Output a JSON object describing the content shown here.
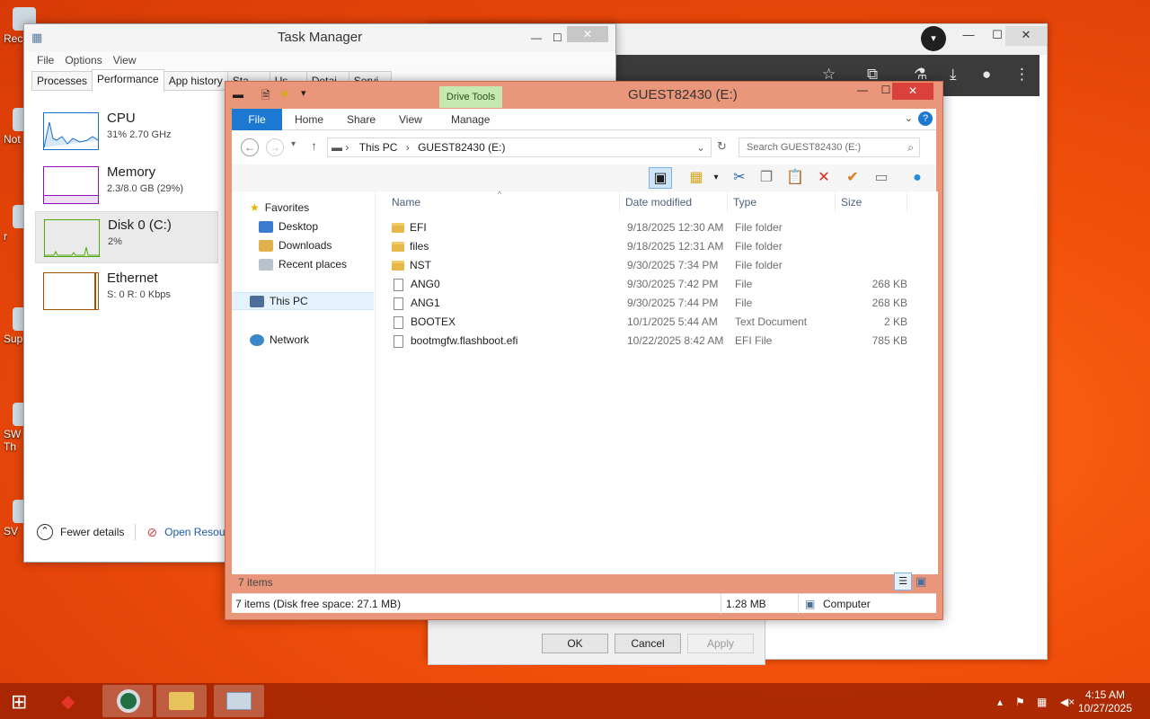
{
  "desktop": {
    "icons": [
      {
        "label": "Rec",
        "icon": "recycle-bin-icon"
      },
      {
        "label": "Not",
        "icon": "app-shortcut-icon"
      },
      {
        "label": "r",
        "icon": "app-shortcut-icon"
      },
      {
        "label": "Sup",
        "icon": "app-shortcut-icon"
      },
      {
        "label": "SW Th",
        "icon": "app-shortcut-icon"
      },
      {
        "label": "SV",
        "icon": "app-shortcut-icon"
      }
    ]
  },
  "task_manager": {
    "title": "Task Manager",
    "menu": [
      "File",
      "Options",
      "View"
    ],
    "tabs": [
      "Processes",
      "Performance",
      "App history",
      "Sta",
      "Us",
      "Detai",
      "Servi"
    ],
    "active_tab": "Performance",
    "items": [
      {
        "name": "CPU",
        "detail": "31% 2.70 GHz",
        "color": "#1a6fc2"
      },
      {
        "name": "Memory",
        "detail": "2.3/8.0 GB (29%)",
        "color": "#8b12ae"
      },
      {
        "name": "Disk 0 (C:)",
        "detail": "2%",
        "color": "#4da60c"
      },
      {
        "name": "Ethernet",
        "detail": "S: 0 R: 0 Kbps",
        "color": "#a74f01"
      }
    ],
    "fewer_details": "Fewer details",
    "open_resource": "Open Resource"
  },
  "explorer": {
    "title": "GUEST82430 (E:)",
    "context_tab": "Drive Tools",
    "ribbon_tabs": [
      "File",
      "Home",
      "Share",
      "View",
      "Manage"
    ],
    "breadcrumb": [
      "This PC",
      "GUEST82430 (E:)"
    ],
    "search_placeholder": "Search GUEST82430 (E:)",
    "nav": {
      "favorites": "Favorites",
      "desktop": "Desktop",
      "downloads": "Downloads",
      "recent": "Recent places",
      "this_pc": "This PC",
      "network": "Network"
    },
    "columns": {
      "name": "Name",
      "date": "Date modified",
      "type": "Type",
      "size": "Size"
    },
    "files": [
      {
        "name": "EFI",
        "date": "9/18/2025 12:30 AM",
        "type": "File folder",
        "size": "",
        "kind": "folder"
      },
      {
        "name": "files",
        "date": "9/18/2025 12:31 AM",
        "type": "File folder",
        "size": "",
        "kind": "folder"
      },
      {
        "name": "NST",
        "date": "9/30/2025 7:34 PM",
        "type": "File folder",
        "size": "",
        "kind": "folder"
      },
      {
        "name": "ANG0",
        "date": "9/30/2025 7:42 PM",
        "type": "File",
        "size": "268 KB",
        "kind": "file"
      },
      {
        "name": "ANG1",
        "date": "9/30/2025 7:44 PM",
        "type": "File",
        "size": "268 KB",
        "kind": "file"
      },
      {
        "name": "BOOTEX",
        "date": "10/1/2025 5:44 AM",
        "type": "Text Document",
        "size": "2 KB",
        "kind": "file"
      },
      {
        "name": "bootmgfw.flashboot.efi",
        "date": "10/22/2025 8:42 AM",
        "type": "EFI File",
        "size": "785 KB",
        "kind": "file"
      }
    ],
    "item_count": "7 items",
    "status_left": "7 items (Disk free space: 27.1 MB)",
    "status_size": "1.28 MB",
    "status_location": "Computer"
  },
  "dialog": {
    "ok": "OK",
    "cancel": "Cancel",
    "apply": "Apply"
  },
  "taskbar": {
    "time": "4:15 AM",
    "date": "10/27/2025"
  }
}
